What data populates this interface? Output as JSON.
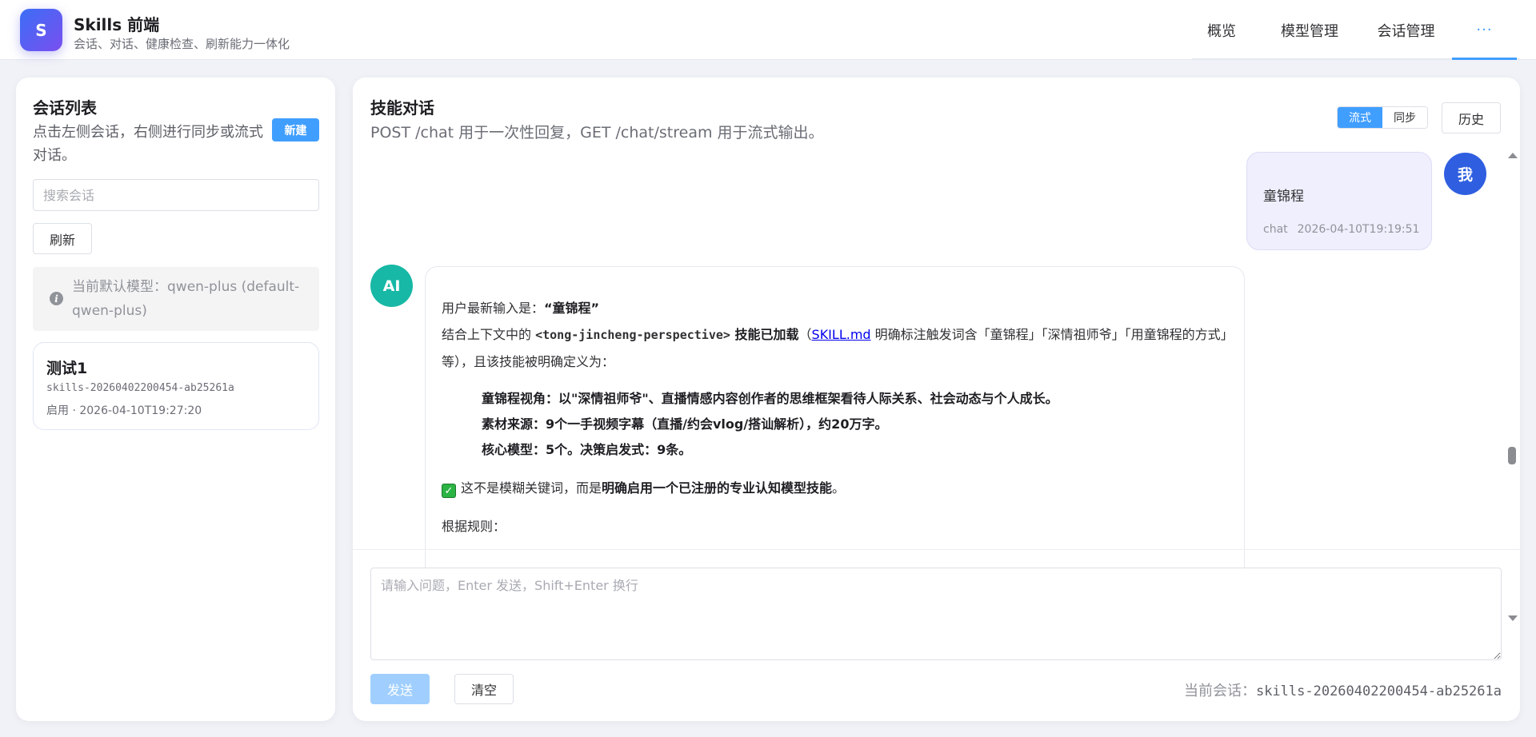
{
  "header": {
    "logo_letter": "S",
    "title": "Skills 前端",
    "subtitle": "会话、对话、健康检查、刷新能力一体化",
    "nav": [
      {
        "label": "概览"
      },
      {
        "label": "模型管理"
      },
      {
        "label": "会话管理"
      },
      {
        "label": "···"
      }
    ],
    "accent_color": "#409eff"
  },
  "sidebar": {
    "title": "会话列表",
    "description": "点击左侧会话，右侧进行同步或流式对话。",
    "new_label": "新建",
    "search_placeholder": "搜索会话",
    "refresh_label": "刷新",
    "model_info": "当前默认模型：qwen-plus (default-qwen-plus)",
    "info_icon": "info-icon",
    "sessions": [
      {
        "name": "测试1",
        "id": "skills-20260402200454-ab25261a",
        "meta": "启用 · 2026-04-10T19:27:20"
      }
    ]
  },
  "chat": {
    "title": "技能对话",
    "description": "POST /chat 用于一次性回复，GET /chat/stream 用于流式输出。",
    "mode_stream": "流式",
    "mode_sync": "同步",
    "history_label": "历史",
    "user_avatar": "我",
    "ai_avatar": "AI",
    "user_message": {
      "text": "童锦程",
      "type": "chat",
      "timestamp": "2026-04-10T19:19:51"
    },
    "ai_message": {
      "line1_prefix": "用户最新输入是：",
      "line1_bold": "“童锦程”",
      "line2_a": "结合上下文中的 ",
      "line2_code": "<tong-jincheng-perspective>",
      "line2_bold": " 技能已加载",
      "line2_b": "（",
      "line2_link": "SKILL.md",
      "line2_c": " 明确标注触发词含「童锦程」「深情祖师爷」「用童锦程的方式」等），且该技能被明确定义为：",
      "list": [
        "童锦程视角：以\"深情祖师爷\"、直播情感内容创作者的思维框架看待人际关系、社会动态与个人成长。",
        "素材来源：9个一手视频字幕（直播/约会vlog/搭讪解析），约20万字。",
        "核心模型：5个。决策启发式：9条。"
      ],
      "check_icon": "checkmark-icon",
      "check_a": "这不是模糊关键词，而是",
      "check_bold": "明确启用一个已注册的专业认知模型技能",
      "check_b": "。",
      "rule_line": "根据规则："
    },
    "input_placeholder": "请输入问题，Enter 发送，Shift+Enter 换行",
    "input_value": "",
    "send_label": "发送",
    "clear_label": "清空",
    "current_session_label": "当前会话：",
    "current_session_id": "skills-20260402200454-ab25261a"
  }
}
